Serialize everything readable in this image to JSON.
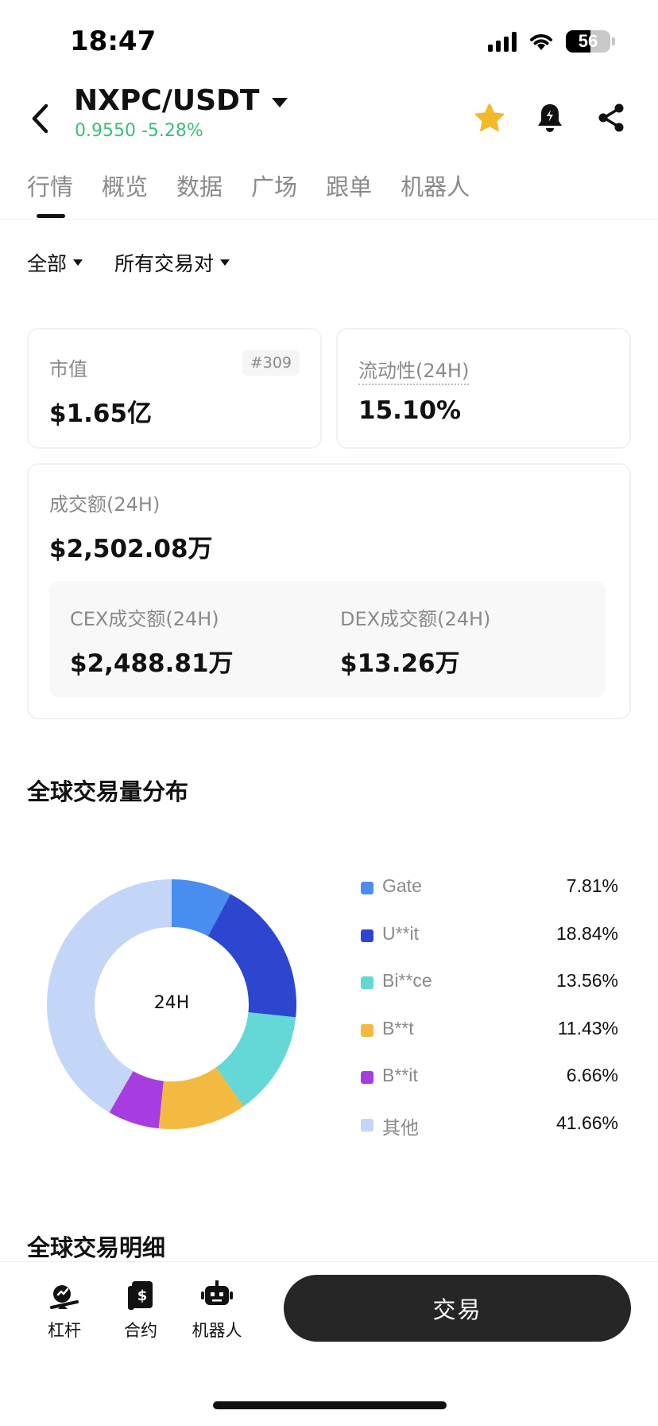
{
  "status_bar": {
    "time": "18:47",
    "battery": "56"
  },
  "header": {
    "pair": "NXPC/USDT",
    "price": "0.9550",
    "change": "-5.28%",
    "change_color": "#3dbd7d"
  },
  "tabs": [
    {
      "label": "行情",
      "active": true
    },
    {
      "label": "概览"
    },
    {
      "label": "数据"
    },
    {
      "label": "广场"
    },
    {
      "label": "跟单"
    },
    {
      "label": "机器人"
    }
  ],
  "filters": {
    "scope": "全部",
    "pairs": "所有交易对"
  },
  "stats": {
    "market_cap": {
      "label": "市值",
      "value": "$1.65亿",
      "rank": "#309"
    },
    "liquidity": {
      "label": "流动性(24H)",
      "value": "15.10%"
    },
    "volume": {
      "label": "成交额(24H)",
      "value": "$2,502.08万"
    },
    "cex_volume": {
      "label": "CEX成交额(24H)",
      "value": "$2,488.81万"
    },
    "dex_volume": {
      "label": "DEX成交额(24H)",
      "value": "$13.26万"
    }
  },
  "distribution": {
    "title": "全球交易量分布",
    "center_label": "24H"
  },
  "chart_data": {
    "type": "pie",
    "variant": "donut",
    "center_text": "24H",
    "categories": [
      "Gate",
      "U**it",
      "Bi**ce",
      "B**t",
      "B**it",
      "其他"
    ],
    "values": [
      7.81,
      18.84,
      13.56,
      11.43,
      6.66,
      41.66
    ],
    "value_labels": [
      "7.81%",
      "18.84%",
      "13.56%",
      "11.43%",
      "6.66%",
      "41.66%"
    ],
    "colors": [
      "#4a8df0",
      "#2c46d0",
      "#64d8d6",
      "#f2ba40",
      "#a73de0",
      "#c4d6f7"
    ],
    "legend_position": "right"
  },
  "details": {
    "title": "全球交易明细"
  },
  "bottom_bar": {
    "leverage": "杠杆",
    "contract": "合约",
    "bot": "机器人",
    "trade": "交易"
  }
}
